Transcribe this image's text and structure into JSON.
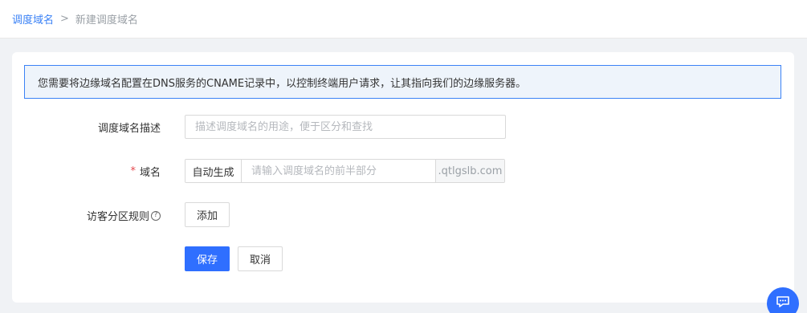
{
  "breadcrumb": {
    "parent": "调度域名",
    "separator": ">",
    "current": "新建调度域名"
  },
  "notice": {
    "text": "您需要将边缘域名配置在DNS服务的CNAME记录中，以控制终端用户请求，让其指向我们的边缘服务器。"
  },
  "form": {
    "description": {
      "label": "调度域名描述",
      "placeholder": "描述调度域名的用途，便于区分和查找"
    },
    "domain": {
      "required_mark": "*",
      "label": "域名",
      "auto_generate_label": "自动生成",
      "placeholder": "请输入调度域名的前半部分",
      "suffix": ".qtlgslb.com"
    },
    "visitor_rules": {
      "label": "访客分区规则",
      "help_glyph": "?",
      "add_label": "添加"
    },
    "actions": {
      "save_label": "保存",
      "cancel_label": "取消"
    }
  },
  "colors": {
    "accent": "#2f6fff",
    "link": "#3b82f6",
    "notice_bg": "#eef4fb",
    "required": "#e5484d"
  },
  "icons": {
    "chat": "chat-bubble-icon",
    "help": "question-circle-icon"
  }
}
